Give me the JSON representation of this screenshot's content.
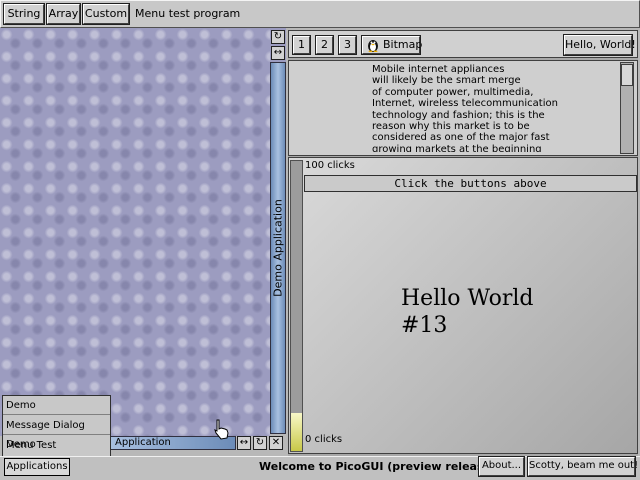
{
  "toolbar": {
    "string_label": "String",
    "array_label": "Array",
    "custom_label": "Custom",
    "title": "Menu test program"
  },
  "app_window": {
    "title": "Demo Application",
    "buttons": [
      "1",
      "2",
      "3"
    ],
    "bitmap_label": "Bitmap",
    "hello_label": "Hello, World!",
    "text_lines": [
      "Mobile internet appliances",
      "will likely be the smart merge",
      "of computer power, multimedia,",
      "Internet, wireless telecommunication",
      "technology and fashion; this is the",
      "reason why this market is to be",
      "considered as one of the major fast",
      "growing markets at the beginning"
    ],
    "clicks_max": "100 clicks",
    "clicks_min": "0 clicks",
    "progress_fraction": 0.13,
    "instruction": "Click the buttons above",
    "hello_text": "Hello World",
    "hello_count": "#13"
  },
  "minimized_app": {
    "label": "Application"
  },
  "menu": {
    "items": [
      "Demo",
      "Message Dialog Demo",
      "Menu Test"
    ]
  },
  "taskbar": {
    "apps_label": "Applications",
    "welcome": "Welcome to PicoGUI (preview release)",
    "about_label": "About...",
    "scotty_label": "Scotty, beam me out!"
  },
  "colors": {
    "desktop": "#9c9cc0",
    "title_bar": "#8aa8d0",
    "panel": "#c8c8c8"
  }
}
